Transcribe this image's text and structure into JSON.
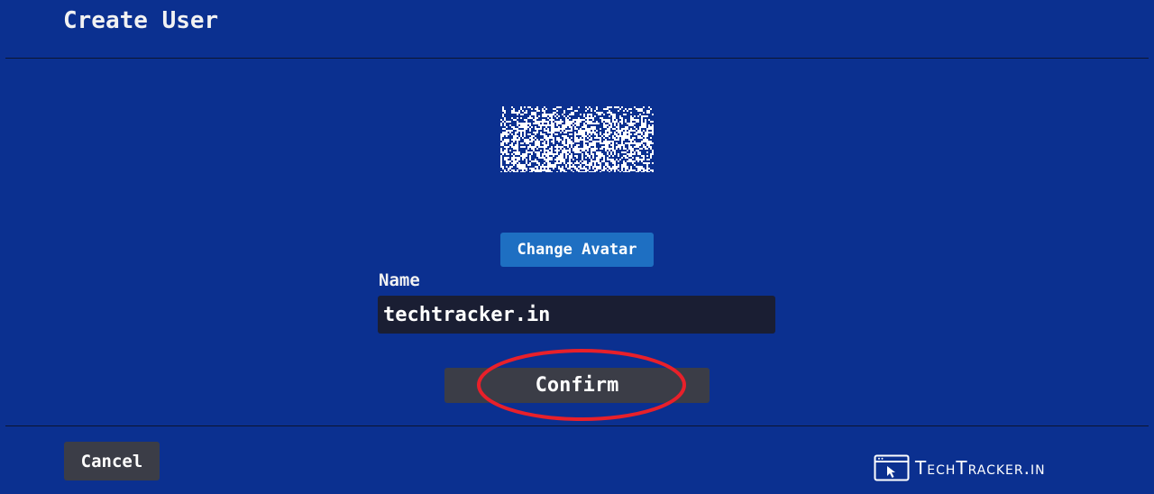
{
  "page": {
    "title": "Create User"
  },
  "avatar": {
    "icon": "avatar-image"
  },
  "buttons": {
    "change_avatar": "Change Avatar",
    "confirm": "Confirm",
    "cancel": "Cancel"
  },
  "name_field": {
    "label": "Name",
    "value": "techtracker.in"
  },
  "annotation": {
    "highlight_color": "#e8202a",
    "shape": "ellipse"
  },
  "watermark": {
    "text": "TechTracker.in",
    "icon": "browser-cursor-icon"
  },
  "colors": {
    "background": "#0b3090",
    "primary_button": "#1e6fc2",
    "secondary_button": "#3b3d47",
    "input_background": "#1a1e33"
  }
}
